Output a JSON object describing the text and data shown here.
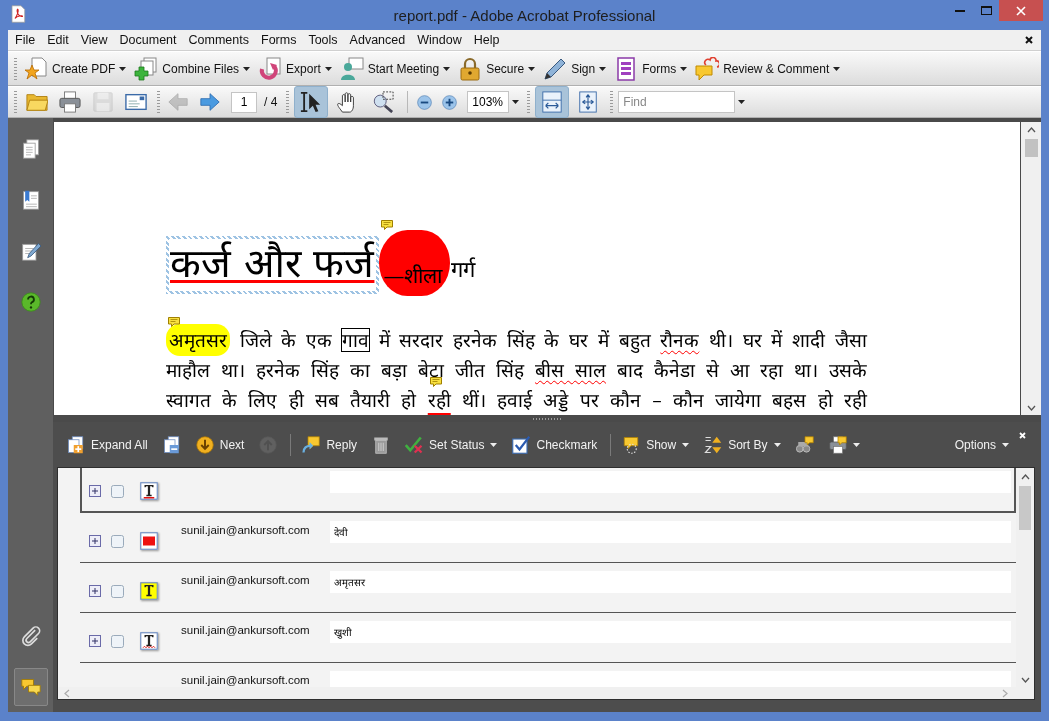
{
  "window": {
    "title": "report.pdf - Adobe Acrobat Professional"
  },
  "menu": {
    "items": [
      "File",
      "Edit",
      "View",
      "Document",
      "Comments",
      "Forms",
      "Tools",
      "Advanced",
      "Window",
      "Help"
    ]
  },
  "task_toolbar": [
    {
      "kind": "create-pdf",
      "label": "Create PDF"
    },
    {
      "kind": "combine",
      "label": "Combine Files"
    },
    {
      "kind": "export",
      "label": "Export"
    },
    {
      "kind": "meeting",
      "label": "Start Meeting"
    },
    {
      "kind": "secure",
      "label": "Secure"
    },
    {
      "kind": "sign",
      "label": "Sign"
    },
    {
      "kind": "forms",
      "label": "Forms"
    },
    {
      "kind": "review",
      "label": "Review & Comment"
    }
  ],
  "file_toolbar": {
    "file_buttons": [
      {
        "kind": "open",
        "disabled": false
      },
      {
        "kind": "print",
        "disabled": false
      },
      {
        "kind": "save",
        "disabled": true
      },
      {
        "kind": "email",
        "disabled": false
      }
    ],
    "page_buttons": [
      {
        "kind": "previous-page",
        "disabled": true
      },
      {
        "kind": "next-page",
        "disabled": false
      }
    ],
    "page": {
      "value": "1",
      "total": "/ 4"
    },
    "tools": [
      {
        "kind": "select",
        "selected": true
      },
      {
        "kind": "hand",
        "selected": false
      },
      {
        "kind": "marquee",
        "selected": false
      }
    ],
    "zoom_buttons": [
      {
        "kind": "zoom-out"
      },
      {
        "kind": "zoom-in"
      }
    ],
    "zoom": {
      "value": "103%"
    },
    "view_buttons": [
      {
        "kind": "fit-width",
        "selected": true
      },
      {
        "kind": "fit-page",
        "selected": false
      }
    ],
    "find": {
      "placeholder": "Find"
    }
  },
  "nav_panel": {
    "top": [
      {
        "kind": "pages",
        "selected": false
      },
      {
        "kind": "bookmarks",
        "selected": false
      },
      {
        "kind": "signatures",
        "selected": false
      },
      {
        "kind": "help",
        "selected": false
      }
    ],
    "bottom": [
      {
        "kind": "attachments",
        "selected": false
      },
      {
        "kind": "comments",
        "selected": true
      }
    ]
  },
  "document": {
    "heading": [
      {
        "text": "कर्ज और फर्ज",
        "kind": "underline",
        "selected": true,
        "note": false
      },
      {
        "text": "—शीला",
        "kind": "oval",
        "selected": false,
        "note": true
      },
      {
        "text": "गर्ग",
        "kind": "plain",
        "selected": false,
        "note": false
      }
    ],
    "lines": [
      [
        {
          "text": "अमृतसर",
          "kind": "highlight",
          "note": true
        },
        {
          "text": "जिले के एक",
          "kind": "plain",
          "note": false
        },
        {
          "text": "गाव",
          "kind": "rectangle",
          "note": false
        },
        {
          "text": "में सरदार हरनेक सिंह के घर में बहुत",
          "kind": "plain",
          "note": false
        },
        {
          "text": "रौनक",
          "kind": "squiggly",
          "note": false
        },
        {
          "text": "थी। घर में शादी जैसा",
          "kind": "plain",
          "note": false
        }
      ],
      [
        {
          "text": "माहौल था। हरनेक सिंह का बड़ा बेटा जीत सिंह",
          "kind": "plain",
          "note": false
        },
        {
          "text": "बीस साल",
          "kind": "squiggly",
          "note": false
        },
        {
          "text": "बाद कैनेडा से आ रहा था। उसके",
          "kind": "plain",
          "note": false
        }
      ],
      [
        {
          "text": "स्वागत के लिए ही सब तैयारी हो",
          "kind": "plain",
          "note": false
        },
        {
          "text": "रही",
          "kind": "underline",
          "note": true
        },
        {
          "text": "थीं। हवाई अड्डे पर कौन – कौन जायेगा बहस हो रही",
          "kind": "plain",
          "note": false
        }
      ]
    ]
  },
  "comments_panel": {
    "toolbar": [
      [
        {
          "kind": "expand-all",
          "label": "Expand All",
          "dropdown": false,
          "disabled": false
        },
        {
          "kind": "collapse-all",
          "dropdown": false,
          "disabled": false
        },
        {
          "kind": "next",
          "label": "Next",
          "dropdown": false,
          "disabled": false
        },
        {
          "kind": "previous",
          "dropdown": false,
          "disabled": true
        }
      ],
      [
        {
          "kind": "reply",
          "label": "Reply",
          "dropdown": false,
          "disabled": false
        },
        {
          "kind": "delete",
          "dropdown": false,
          "disabled": false
        },
        {
          "kind": "set-status",
          "label": "Set Status",
          "dropdown": true,
          "disabled": false
        },
        {
          "kind": "checkmark",
          "label": "Checkmark",
          "dropdown": false,
          "disabled": false
        }
      ],
      [
        {
          "kind": "show",
          "label": "Show",
          "dropdown": true,
          "disabled": false
        },
        {
          "kind": "sort",
          "label": "Sort By",
          "dropdown": true,
          "disabled": false
        },
        {
          "kind": "search",
          "dropdown": false,
          "disabled": false
        },
        {
          "kind": "print",
          "dropdown": true,
          "disabled": false
        }
      ]
    ],
    "options": {
      "label": "Options"
    },
    "rows": [
      {
        "kind": "underline",
        "selected": true,
        "expanded": false,
        "checked": false
      },
      {
        "kind": "shape",
        "author": "sunil.jain@ankursoft.com",
        "comment": "देवी",
        "selected": false,
        "expanded": false,
        "checked": false
      },
      {
        "kind": "highlight",
        "author": "sunil.jain@ankursoft.com",
        "comment": "अमृतसर",
        "selected": false,
        "expanded": false,
        "checked": false
      },
      {
        "kind": "squiggly",
        "author": "sunil.jain@ankursoft.com",
        "comment": "खुशी",
        "selected": false,
        "expanded": false,
        "checked": false
      },
      {
        "author": "sunil.jain@ankursoft.com",
        "selected": false
      }
    ]
  }
}
